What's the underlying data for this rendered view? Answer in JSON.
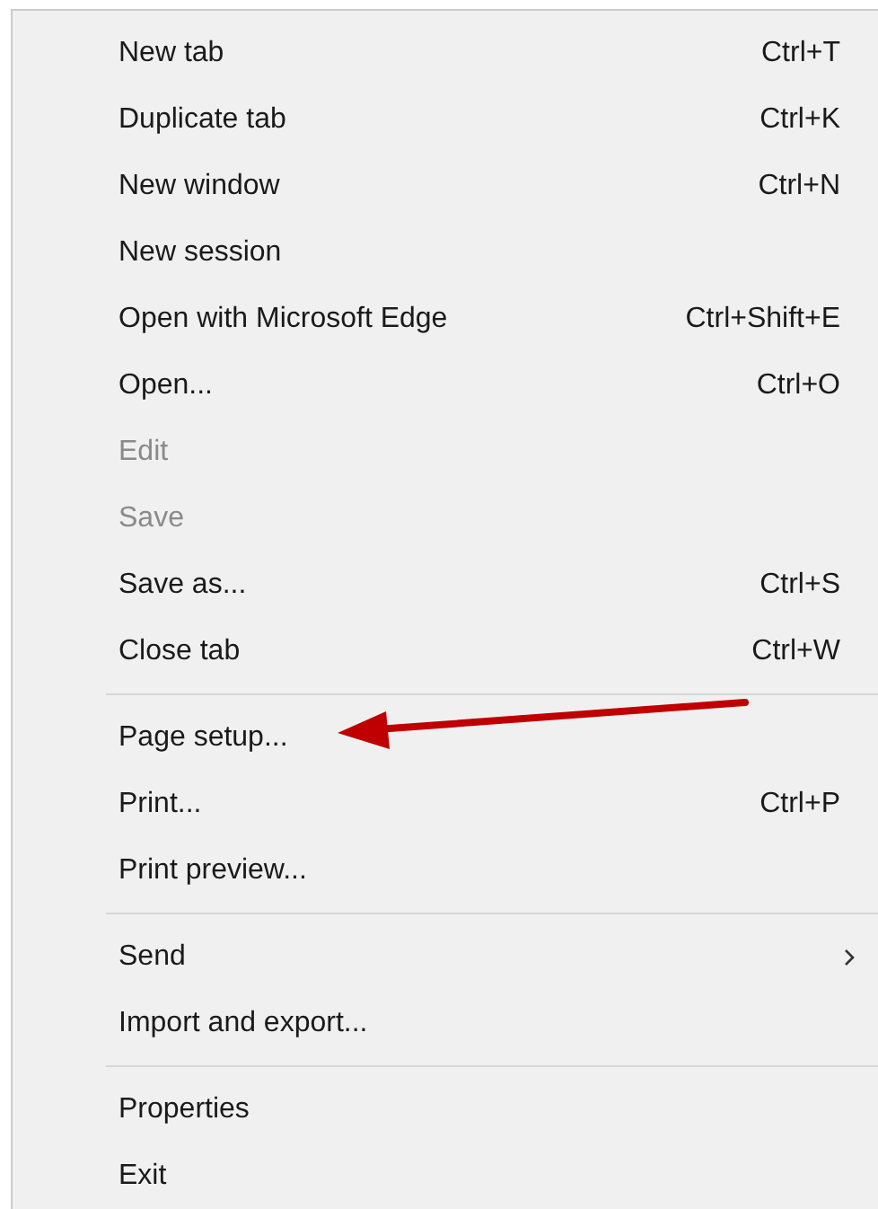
{
  "menu": {
    "items": [
      {
        "kind": "item",
        "label": "New tab",
        "shortcut": "Ctrl+T",
        "disabled": false,
        "submenu": false
      },
      {
        "kind": "item",
        "label": "Duplicate tab",
        "shortcut": "Ctrl+K",
        "disabled": false,
        "submenu": false
      },
      {
        "kind": "item",
        "label": "New window",
        "shortcut": "Ctrl+N",
        "disabled": false,
        "submenu": false
      },
      {
        "kind": "item",
        "label": "New session",
        "disabled": false,
        "submenu": false
      },
      {
        "kind": "item",
        "label": "Open with Microsoft Edge",
        "shortcut": "Ctrl+Shift+E",
        "disabled": false,
        "submenu": false
      },
      {
        "kind": "item",
        "label": "Open...",
        "shortcut": "Ctrl+O",
        "disabled": false,
        "submenu": false
      },
      {
        "kind": "item",
        "label": "Edit",
        "disabled": true,
        "submenu": false
      },
      {
        "kind": "item",
        "label": "Save",
        "disabled": true,
        "submenu": false
      },
      {
        "kind": "item",
        "label": "Save as...",
        "shortcut": "Ctrl+S",
        "disabled": false,
        "submenu": false
      },
      {
        "kind": "item",
        "label": "Close tab",
        "shortcut": "Ctrl+W",
        "disabled": false,
        "submenu": false
      },
      {
        "kind": "separator"
      },
      {
        "kind": "item",
        "label": "Page setup...",
        "disabled": false,
        "submenu": false
      },
      {
        "kind": "item",
        "label": "Print...",
        "shortcut": "Ctrl+P",
        "disabled": false,
        "submenu": false
      },
      {
        "kind": "item",
        "label": "Print preview...",
        "disabled": false,
        "submenu": false
      },
      {
        "kind": "separator"
      },
      {
        "kind": "item",
        "label": "Send",
        "disabled": false,
        "submenu": true
      },
      {
        "kind": "item",
        "label": "Import and export...",
        "disabled": false,
        "submenu": false
      },
      {
        "kind": "separator"
      },
      {
        "kind": "item",
        "label": "Properties",
        "disabled": false,
        "submenu": false
      },
      {
        "kind": "item",
        "label": "Exit",
        "disabled": false,
        "submenu": false
      }
    ]
  }
}
